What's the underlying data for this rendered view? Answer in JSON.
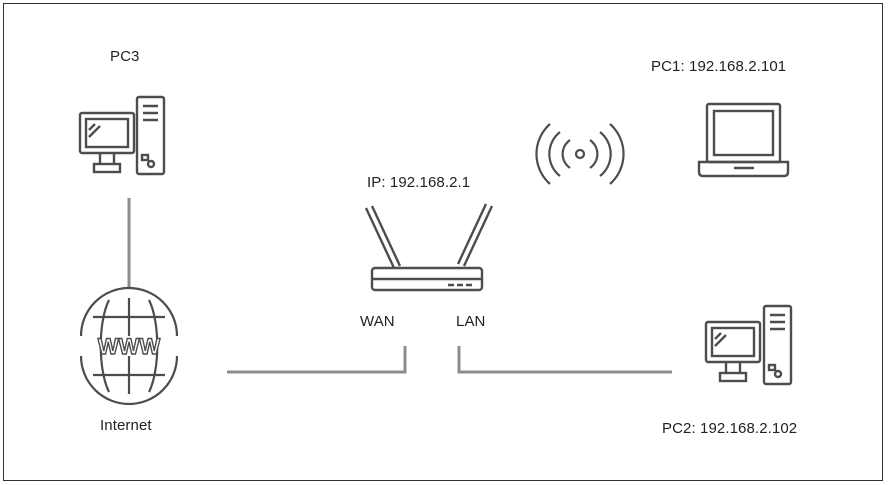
{
  "colors": {
    "line": "#8c8c8c",
    "icon": "#4d4d4d",
    "text": "#222222",
    "border": "#333333"
  },
  "nodes": {
    "pc3": {
      "label": "PC3",
      "icon": "desktop-pc-icon"
    },
    "internet": {
      "label": "Internet",
      "icon": "globe-www-icon",
      "glyph": "WWW"
    },
    "router": {
      "label": "IP: 192.168.2.1",
      "icon": "router-icon",
      "wan_label": "WAN",
      "lan_label": "LAN"
    },
    "pc1": {
      "label": "PC1: 192.168.2.101",
      "icon": "laptop-icon"
    },
    "pc2": {
      "label": "PC2: 192.168.2.102",
      "icon": "desktop-pc-icon"
    },
    "wifi": {
      "icon": "wifi-signal-icon"
    }
  },
  "links": [
    {
      "from": "pc3",
      "to": "internet"
    },
    {
      "from": "internet",
      "to": "router-wan"
    },
    {
      "from": "router-lan",
      "to": "pc2"
    }
  ]
}
